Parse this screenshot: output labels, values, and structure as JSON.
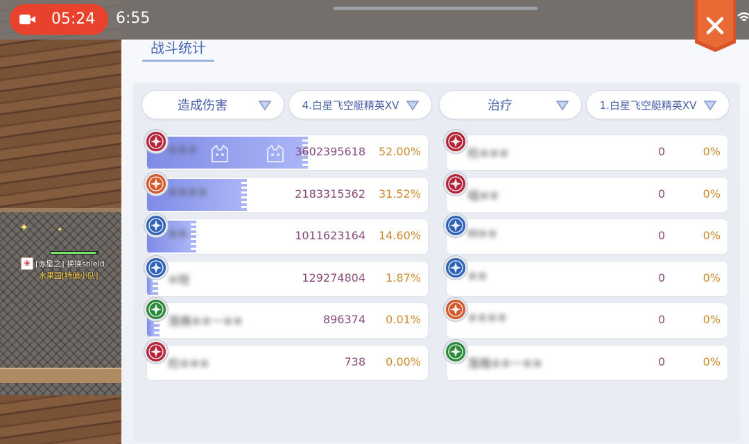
{
  "status_bar": {
    "recording_time": "05:24",
    "clock": "6:55",
    "record_icon": "video-camera-icon",
    "wifi_icon": "wifi-icon"
  },
  "game": {
    "player_tag": {
      "name": "[赤星之] 换换shield",
      "guild": "水果园[特偏小队]"
    }
  },
  "panel": {
    "tab_label": "战斗统计",
    "close_icon": "close-icon"
  },
  "left": {
    "metric_select": "造成伤害",
    "stage_select": "4.白星飞空艇精英XV",
    "rows": [
      {
        "name": "※※※",
        "badge_color": "#b5253a",
        "value": "3602395618",
        "pct": "52.00%",
        "fill": 0.52
      },
      {
        "name": "※※※※",
        "badge_color": "#d5572c",
        "value": "2183315362",
        "pct": "31.52%",
        "fill": 0.3152
      },
      {
        "name": "※※",
        "badge_color": "#2f63b8",
        "value": "1011623164",
        "pct": "14.60%",
        "fill": 0.146
      },
      {
        "name": "※晓",
        "badge_color": "#2f63b8",
        "value": "129274804",
        "pct": "1.87%",
        "fill": 0.0187
      },
      {
        "name": "落魄※※一※※",
        "badge_color": "#2a8a3a",
        "value": "896374",
        "pct": "0.01%",
        "fill": 0.0001
      },
      {
        "name": "检※※※",
        "badge_color": "#b5253a",
        "value": "738",
        "pct": "0.00%",
        "fill": 0
      }
    ]
  },
  "right": {
    "metric_select": "治疗",
    "stage_select": "1.白星飞空艇精英XV",
    "rows": [
      {
        "name": "检※※※",
        "badge_color": "#b5253a",
        "value": "0",
        "pct": "0%"
      },
      {
        "name": "喵※※",
        "badge_color": "#b5253a",
        "value": "0",
        "pct": "0%"
      },
      {
        "name": "M※※",
        "badge_color": "#2f63b8",
        "value": "0",
        "pct": "0%"
      },
      {
        "name": "※※",
        "badge_color": "#2f63b8",
        "value": "0",
        "pct": "0%"
      },
      {
        "name": "※※※※",
        "badge_color": "#d5572c",
        "value": "0",
        "pct": "0%"
      },
      {
        "name": "落魄※※一※※",
        "badge_color": "#2a8a3a",
        "value": "0",
        "pct": "0%"
      }
    ]
  }
}
